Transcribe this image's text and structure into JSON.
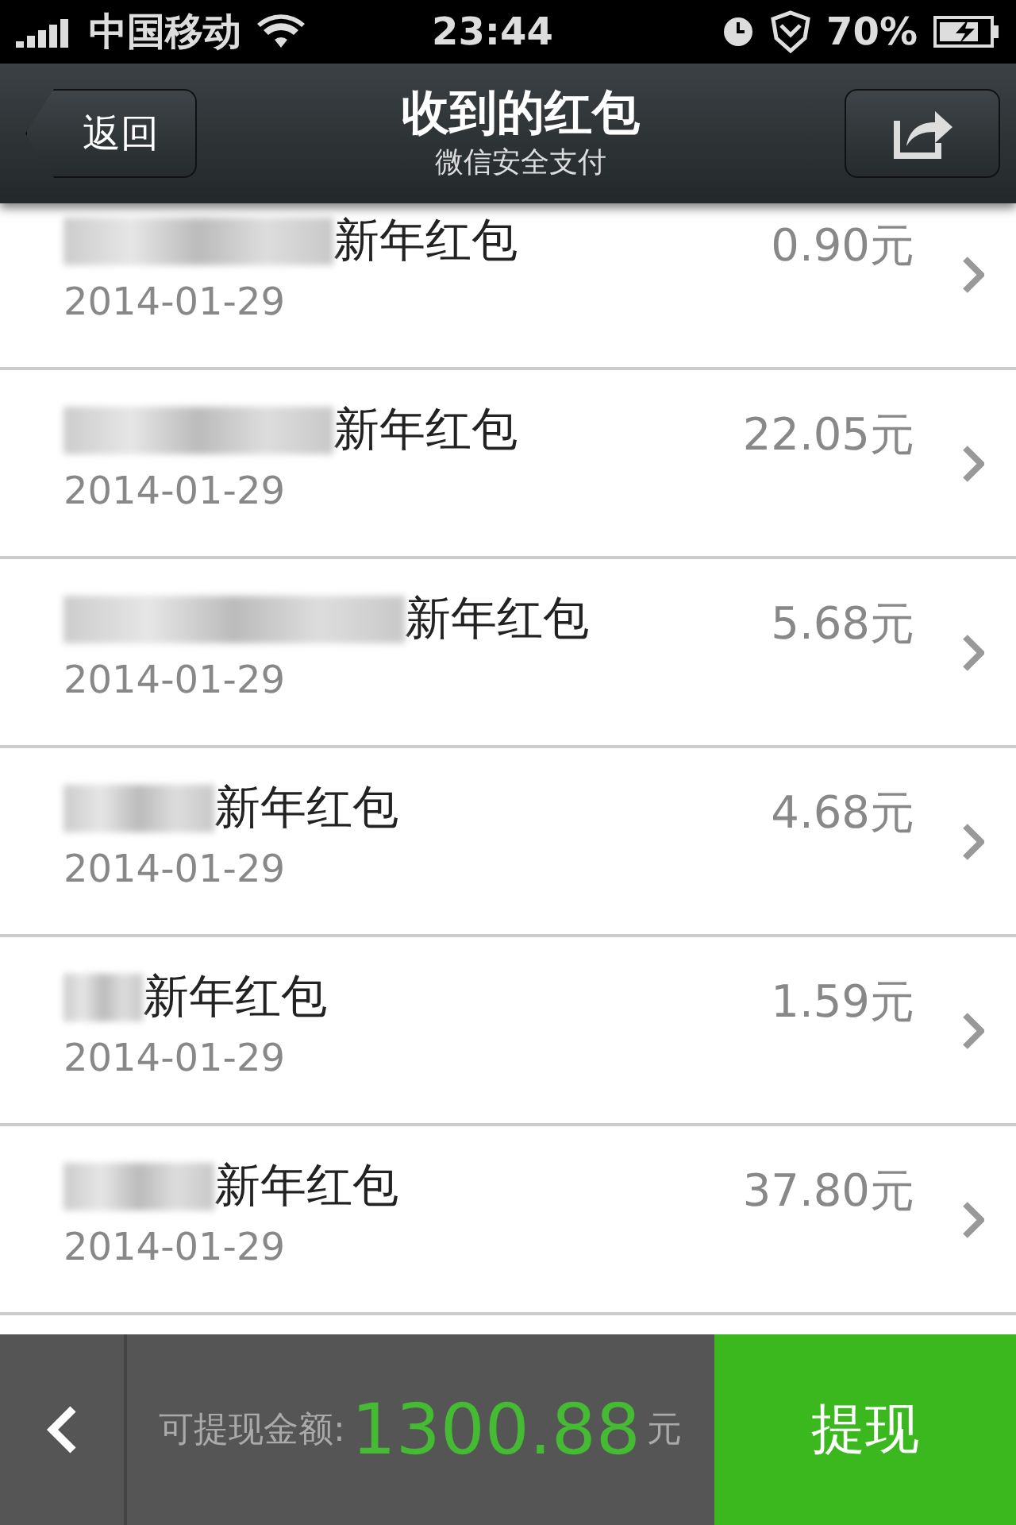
{
  "status_bar": {
    "carrier": "中国移动",
    "time": "23:44",
    "battery": "70%"
  },
  "nav_bar": {
    "back": "返回",
    "title": "收到的红包",
    "subtitle": "微信安全支付"
  },
  "packets": [
    {
      "title": "新年红包",
      "date": "2014-01-29",
      "amount": "0.90元"
    },
    {
      "title": "新年红包",
      "date": "2014-01-29",
      "amount": "22.05元"
    },
    {
      "title": "新年红包",
      "date": "2014-01-29",
      "amount": "5.68元"
    },
    {
      "title": "新年红包",
      "date": "2014-01-29",
      "amount": "4.68元"
    },
    {
      "title": "新年红包",
      "date": "2014-01-29",
      "amount": "1.59元"
    },
    {
      "title": "新年红包",
      "date": "2014-01-29",
      "amount": "37.80元"
    }
  ],
  "footer": {
    "label": "可提现金额:",
    "amount": "1300.88",
    "unit": "元",
    "withdraw": "提现"
  }
}
